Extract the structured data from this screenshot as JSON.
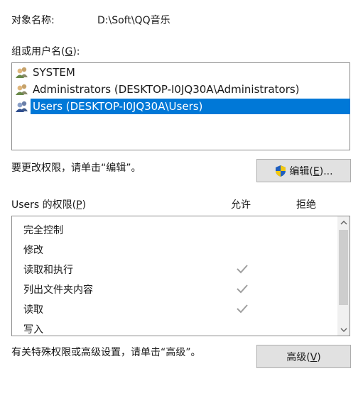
{
  "object": {
    "label": "对象名称:",
    "value": "D:\\Soft\\QQ音乐"
  },
  "groups": {
    "label_prefix": "组或用户名(",
    "label_key": "G",
    "label_suffix": "):",
    "items": [
      {
        "name": "SYSTEM",
        "icon": "users-group-icon",
        "selected": false
      },
      {
        "name": "Administrators (DESKTOP-I0JQ30A\\Administrators)",
        "icon": "users-group-icon",
        "selected": false
      },
      {
        "name": "Users (DESKTOP-I0JQ30A\\Users)",
        "icon": "users-group-icon",
        "selected": true
      }
    ]
  },
  "change_hint": "要更改权限，请单击“编辑”。",
  "edit_button": {
    "label_prefix": "编辑(",
    "label_key": "E",
    "label_suffix": ")...",
    "icon": "uac-shield-icon"
  },
  "permissions": {
    "title_prefix": "Users 的权限(",
    "title_key": "P",
    "title_suffix": ")",
    "col_allow": "允许",
    "col_deny": "拒绝",
    "rows": [
      {
        "name": "完全控制",
        "allow": false,
        "deny": false
      },
      {
        "name": "修改",
        "allow": false,
        "deny": false
      },
      {
        "name": "读取和执行",
        "allow": true,
        "deny": false
      },
      {
        "name": "列出文件夹内容",
        "allow": true,
        "deny": false
      },
      {
        "name": "读取",
        "allow": true,
        "deny": false
      },
      {
        "name": "写入",
        "allow": false,
        "deny": false
      }
    ]
  },
  "advanced_hint": "有关特殊权限或高级设置，请单击“高级”。",
  "advanced_button": {
    "label_prefix": "高级(",
    "label_key": "V",
    "label_suffix": ")"
  },
  "colors": {
    "selection": "#0078d7",
    "check": "#a0a0a0",
    "button_bg": "#e1e1e1"
  }
}
